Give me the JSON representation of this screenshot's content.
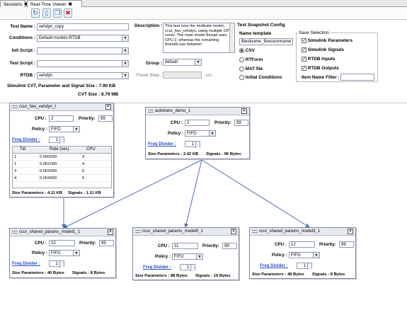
{
  "tabs": [
    {
      "label": "Sessions",
      "close": "✖"
    },
    {
      "label": "Real-Time Viewer",
      "close": "✖"
    }
  ],
  "toolbar": {
    "icons": [
      "refresh-icon",
      "new-document-icon",
      "copy-document-icon",
      "delete-document-icon"
    ]
  },
  "form": {
    "test_name_label": "Test Name :",
    "test_name_value": "vehdyn_copy",
    "conditions_label": "Conditions :",
    "conditions_value": "Default-models-RTDB",
    "init_script_label": "Init Script :",
    "init_script_value": "",
    "test_script_label": "Test Script :",
    "test_script_value": "",
    "rtdb_label": "RTDB :",
    "rtdb_value": "vehdyn",
    "simulink_cvt_label": "Simulink CVT, Parameter and Signal Size : 7.90 KB",
    "cvt_size_label": "CVT Size : 8.79 MB",
    "description_label": "Description :",
    "description_text": "This test runs the multirate model, ccur_hev_vehdyn, using multiple CPU cores. The main model thread uses CPU 2, whereas the remaining threads use between",
    "group_label": "Group :",
    "group_value": "default",
    "fixed_step_label": "Fixed Step :",
    "fixed_step_value": "",
    "fixed_step_unit": "sec"
  },
  "snapshot": {
    "title": "Test Snapshot Config",
    "name_template_label": "Name template",
    "name_template_value": "$testname_$sessionname",
    "formats": [
      {
        "label": "CSV",
        "selected": true
      },
      {
        "label": "RTForm",
        "selected": false
      },
      {
        "label": "MAT file",
        "selected": false
      },
      {
        "label": "Initial Conditions",
        "selected": false
      }
    ],
    "save_selection_label": "Save Selection",
    "save_items": [
      {
        "label": "Simulink Parameters",
        "checked": true
      },
      {
        "label": "Simulink Signals",
        "checked": true
      },
      {
        "label": "RTDB Inputs",
        "checked": true
      },
      {
        "label": "RTDB Outputs",
        "checked": true
      }
    ],
    "item_filter_label": "Item Name Filter :",
    "item_filter_value": ""
  },
  "nodes": {
    "hev": {
      "title": "ccur_hev_vehdyn_t",
      "cpu_label": "CPU :",
      "cpu_value": "2",
      "priority_label": "Priority:",
      "priority_value": "99",
      "policy_label": "Policy :",
      "policy_value": "FIFO",
      "freq_label": "Freq Divider :",
      "freq_value": "1",
      "table_headers": [
        "Tid",
        "Rate (sec)",
        "CPU"
      ],
      "table_rows": [
        [
          "1",
          "0.000500",
          "3"
        ],
        [
          "1",
          "0.001000",
          "4"
        ],
        [
          "3",
          "0.002000",
          "5"
        ],
        [
          "4",
          "0.004000",
          "6"
        ]
      ],
      "footer_params": "Size Parameters : 4.11 KB",
      "footer_signals": "Signals : 1.11 KB"
    },
    "autotrans": {
      "title": "autotrans_demo_1",
      "cpu_label": "CPU :",
      "cpu_value": "2",
      "priority_label": "Priority:",
      "priority_value": "99",
      "policy_label": "Policy :",
      "policy_value": "FIFO",
      "freq_label": "Freq Divider :",
      "freq_value": "1",
      "footer_params": "Size Parameters : 2.42 KB",
      "footer_signals": "Signals : 96 Bytes"
    },
    "shared1": {
      "title": "ccur_shared_params_model1_1",
      "cpu_label": "CPU :",
      "cpu_value": "10",
      "priority_label": "Priority:",
      "priority_value": "99",
      "policy_label": "Policy :",
      "policy_value": "FIFO",
      "freq_label": "Freq Divider :",
      "freq_value": "1",
      "footer_params": "Size Parameters : 40 Bytes",
      "footer_signals": "Signals : 8 Bytes"
    },
    "shared0": {
      "title": "ccur_shared_params_model0_1",
      "cpu_label": "CPU :",
      "cpu_value": "11",
      "priority_label": "Priority:",
      "priority_value": "99",
      "policy_label": "Policy :",
      "policy_value": "FIFO",
      "freq_label": "Freq Divider :",
      "freq_value": "1",
      "footer_params": "Size Parameters : 88 Bytes",
      "footer_signals": "Signals : 16 Bytes"
    },
    "shared3": {
      "title": "ccur_shared_params_model3_1",
      "cpu_label": "CPU :",
      "cpu_value": "12",
      "priority_label": "Priority:",
      "priority_value": "99",
      "policy_label": "Policy :",
      "policy_value": "FIFO",
      "freq_label": "Freq Divider :",
      "freq_value": "1",
      "footer_params": "Size Parameters : 48 Bytes",
      "footer_signals": "Signals : 8 Bytes"
    }
  },
  "colors": {
    "wire": "#4f6fb5",
    "link": "#2a49c7",
    "node_border": "#7b89a6"
  }
}
